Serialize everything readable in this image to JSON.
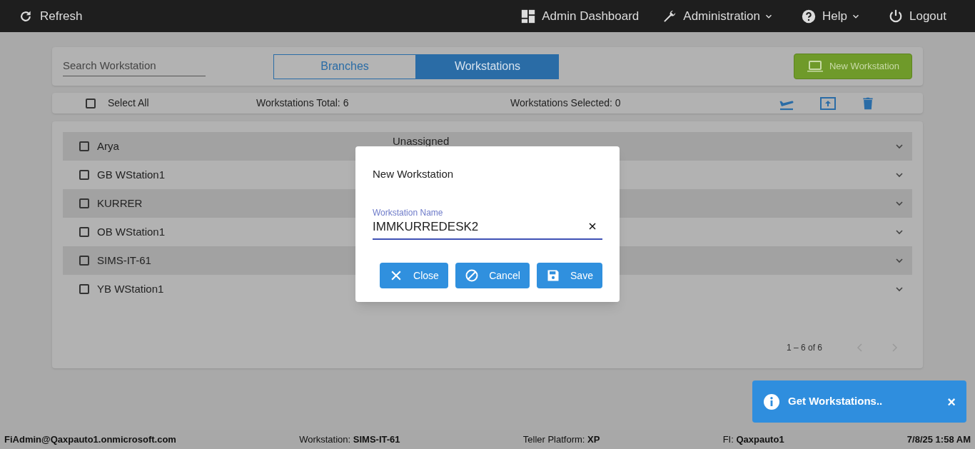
{
  "nav": {
    "refresh": "Refresh",
    "items": [
      {
        "label": "Admin Dashboard",
        "dropdown": false
      },
      {
        "label": "Administration",
        "dropdown": true
      },
      {
        "label": "Help",
        "dropdown": true
      },
      {
        "label": "Logout",
        "dropdown": false
      }
    ]
  },
  "search": {
    "placeholder": "Search Workstation"
  },
  "tabs": [
    {
      "label": "Branches",
      "selected": false
    },
    {
      "label": "Workstations",
      "selected": true
    }
  ],
  "new_button": "New Workstation",
  "toolbar": {
    "select_all": {
      "label": "Select All",
      "checked": false
    },
    "total": "Workstations Total: 6",
    "selected_count": "Workstations Selected: 0"
  },
  "rows": [
    {
      "name": "Arya",
      "checked": false,
      "branch": "Unassigned"
    },
    {
      "name": "GB WStation1",
      "checked": false
    },
    {
      "name": "KURRER",
      "checked": false
    },
    {
      "name": "OB WStation1",
      "checked": false
    },
    {
      "name": "SIMS-IT-61",
      "checked": false
    },
    {
      "name": "YB WStation1",
      "checked": false
    }
  ],
  "pagination": "1 – 6 of 6",
  "dialog": {
    "title": "New Workstation",
    "field_label": "Workstation Name",
    "field_value": "IMMKURREDESK2",
    "buttons": [
      "Close",
      "Cancel",
      "Save"
    ]
  },
  "toast": {
    "message": "Get Workstations..",
    "close": "×"
  },
  "status_bar": [
    {
      "value": "FiAdmin@Qaxpauto1.onmicrosoft.com"
    },
    {
      "label": "Workstation: ",
      "value": "SIMS-IT-61"
    },
    {
      "label": "Teller Platform: ",
      "value": "XP"
    },
    {
      "label": "FI: ",
      "value": "Qaxpauto1"
    },
    {
      "value": "7/8/25 1:58 AM"
    }
  ]
}
